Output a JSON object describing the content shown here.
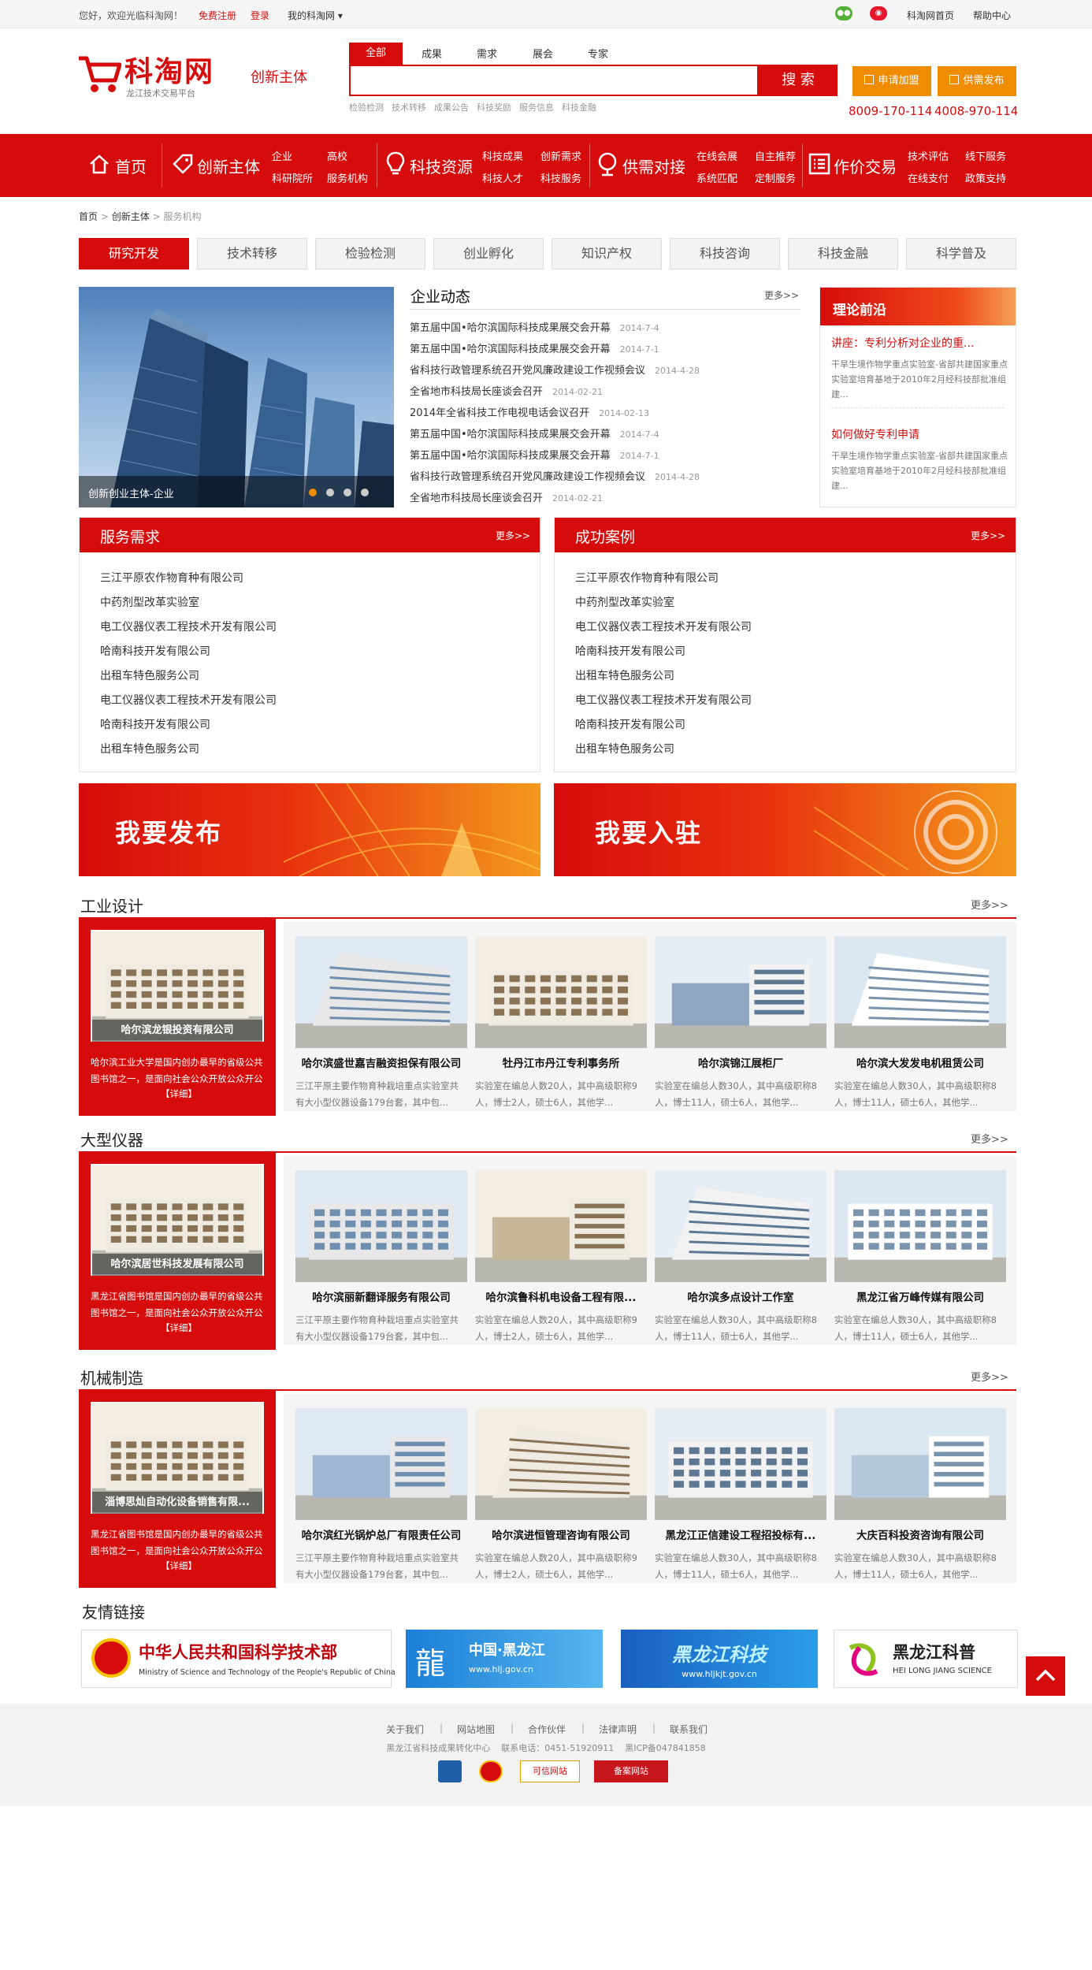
{
  "topbar": {
    "welcome": "您好，欢迎光临科淘网！",
    "register": "免费注册",
    "login": "登录",
    "my": "我的科淘网",
    "home": "科淘网首页",
    "help": "帮助中心"
  },
  "header": {
    "logo_text": "科淘网",
    "logo_sub": "龙江技术交易平台",
    "section": "创新主体",
    "search_tabs": [
      "全部",
      "成果",
      "需求",
      "展会",
      "专家"
    ],
    "search_button": "搜 索",
    "hot_words": [
      "检验检测",
      "技术转移",
      "成果公告",
      "科技奖励",
      "服务信息",
      "科技金融"
    ],
    "apply_join": "申请加盟",
    "post_demand": "供需发布",
    "phone1": "8009-170-114",
    "phone2": "4008-970-114"
  },
  "nav": {
    "items": [
      {
        "label": "首页",
        "subs": []
      },
      {
        "label": "创新主体",
        "subs": [
          "企业",
          "高校",
          "科研院所",
          "服务机构"
        ]
      },
      {
        "label": "科技资源",
        "subs": [
          "科技成果",
          "创新需求",
          "科技人才",
          "科技服务"
        ]
      },
      {
        "label": "供需对接",
        "subs": [
          "在线会展",
          "自主推荐",
          "系统匹配",
          "定制服务"
        ]
      },
      {
        "label": "作价交易",
        "subs": [
          "技术评估",
          "线下服务",
          "在线支付",
          "政策支持"
        ]
      }
    ]
  },
  "breadcrumb": [
    "首页",
    "创新主体",
    "服务机构"
  ],
  "categories": [
    "研究开发",
    "技术转移",
    "检验检测",
    "创业孵化",
    "知识产权",
    "科技咨询",
    "科技金融",
    "科学普及"
  ],
  "slider": {
    "caption": "创新创业主体-企业"
  },
  "news": {
    "title": "企业动态",
    "more": "更多>>",
    "items": [
      {
        "t": "第五届中国•哈尔滨国际科技成果展交会开幕",
        "d": "2014-7-4"
      },
      {
        "t": "第五届中国•哈尔滨国际科技成果展交会开幕",
        "d": "2014-7-1"
      },
      {
        "t": "省科技行政管理系统召开党风廉政建设工作视频会议",
        "d": "2014-4-28"
      },
      {
        "t": "全省地市科技局长座谈会召开",
        "d": "2014-02-21"
      },
      {
        "t": "2014年全省科技工作电视电话会议召开",
        "d": "2014-02-13"
      },
      {
        "t": "第五届中国•哈尔滨国际科技成果展交会开幕",
        "d": "2014-7-4"
      },
      {
        "t": "第五届中国•哈尔滨国际科技成果展交会开幕",
        "d": "2014-7-1"
      },
      {
        "t": "省科技行政管理系统召开党风廉政建设工作视频会议",
        "d": "2014-4-28"
      },
      {
        "t": "全省地市科技局长座谈会召开",
        "d": "2014-02-21"
      }
    ]
  },
  "theory": {
    "title": "理论前沿",
    "items": [
      {
        "t": "讲座：专利分析对企业的重...",
        "d": "干旱生境作物学重点实验室-省部共建国家重点实验室培育基地于2010年2月经科技部批准组建..."
      },
      {
        "t": "如何做好专利申请",
        "d": "干旱生境作物学重点实验室-省部共建国家重点实验室培育基地于2010年2月经科技部批准组建..."
      }
    ]
  },
  "service_demand": {
    "title": "服务需求",
    "more": "更多>>",
    "items": [
      "三江平原农作物育种有限公司",
      "中药剂型改革实验室",
      "电工仪器仪表工程技术开发有限公司",
      "哈南科技开发有限公司",
      "出租车特色服务公司",
      "电工仪器仪表工程技术开发有限公司",
      "哈南科技开发有限公司",
      "出租车特色服务公司"
    ]
  },
  "success_cases": {
    "title": "成功案例",
    "more": "更多>>",
    "items": [
      "三江平原农作物育种有限公司",
      "中药剂型改革实验室",
      "电工仪器仪表工程技术开发有限公司",
      "哈南科技开发有限公司",
      "出租车特色服务公司",
      "电工仪器仪表工程技术开发有限公司",
      "哈南科技开发有限公司",
      "出租车特色服务公司"
    ]
  },
  "banners": {
    "publish": "我要发布",
    "settle": "我要入驻"
  },
  "sections": [
    {
      "title": "工业设计",
      "more": "更多>>",
      "feature": {
        "name": "哈尔滨龙银投资有限公司",
        "desc": "哈尔滨工业大学是国内创办最早的省级公共图书馆之一，是面向社会公众开放公众开公众开公...",
        "detail": "【详细】"
      },
      "cards": [
        {
          "name": "哈尔滨盛世嘉吉融资担保有限公司",
          "desc": "三江平原主要作物育种栽培重点实验室共有大小型仪器设备179台套，其中包..."
        },
        {
          "name": "牡丹江市丹江专利事务所",
          "desc": "实验室在编总人数20人，其中高级职称9人，博士2人，硕士6人，其他学..."
        },
        {
          "name": "哈尔滨锦江展柜厂",
          "desc": "实验室在编总人数30人，其中高级职称8人，博士11人，硕士6人，其他学..."
        },
        {
          "name": "哈尔滨大发发电机租赁公司",
          "desc": "实验室在编总人数30人，其中高级职称8人，博士11人，硕士6人，其他学..."
        }
      ]
    },
    {
      "title": "大型仪器",
      "more": "更多>>",
      "feature": {
        "name": "哈尔滨居世科技发展有限公司",
        "desc": "黑龙江省图书馆是国内创办最早的省级公共图书馆之一，是面向社会公众开放公众开公众开公...",
        "detail": "【详细】"
      },
      "cards": [
        {
          "name": "哈尔滨丽新翻译服务有限公司",
          "desc": "三江平原主要作物育种栽培重点实验室共有大小型仪器设备179台套，其中包..."
        },
        {
          "name": "哈尔滨鲁科机电设备工程有限...",
          "desc": "实验室在编总人数20人，其中高级职称9人，博士2人，硕士6人，其他学..."
        },
        {
          "name": "哈尔滨多点设计工作室",
          "desc": "实验室在编总人数30人，其中高级职称8人，博士11人，硕士6人，其他学..."
        },
        {
          "name": "黑龙江省万峰传媒有限公司",
          "desc": "实验室在编总人数30人，其中高级职称8人，博士11人，硕士6人，其他学..."
        }
      ]
    },
    {
      "title": "机械制造",
      "more": "更多>>",
      "feature": {
        "name": "淄博思灿自动化设备销售有限...",
        "desc": "黑龙江省图书馆是国内创办最早的省级公共图书馆之一，是面向社会公众开放公众开公众开公...",
        "detail": "【详细】"
      },
      "cards": [
        {
          "name": "哈尔滨红光锅炉总厂有限责任公司",
          "desc": "三江平原主要作物育种栽培重点实验室共有大小型仪器设备179台套，其中包..."
        },
        {
          "name": "哈尔滨进恒管理咨询有限公司",
          "desc": "实验室在编总人数20人，其中高级职称9人，博士2人，硕士6人，其他学..."
        },
        {
          "name": "黑龙江正信建设工程招投标有...",
          "desc": "实验室在编总人数30人，其中高级职称8人，博士11人，硕士6人，其他学..."
        },
        {
          "name": "大庆百科投资咨询有限公司",
          "desc": "实验室在编总人数30人，其中高级职称8人，博士11人，硕士6人，其他学..."
        }
      ]
    }
  ],
  "friend_links": {
    "title": "友情链接",
    "items": [
      {
        "main": "中华人民共和国科学技术部",
        "sub": "Ministry of Science and Technology of the People's Republic of China"
      },
      {
        "main": "中国·黑龙江",
        "sub": "www.hlj.gov.cn"
      },
      {
        "main": "黑龙江科技",
        "sub": "www.hljkjt.gov.cn"
      },
      {
        "main": "黑龙江科普",
        "sub": "HEI LONG JIANG SCIENCE"
      }
    ]
  },
  "footer": {
    "links": [
      "关于我们",
      "网站地图",
      "合作伙伴",
      "法律声明",
      "联系我们"
    ],
    "org": "黑龙江省科技成果转化中心",
    "phone": "联系电话：0451-51920911",
    "icp": "黑ICP备047841858",
    "badges": [
      "可信网站",
      "备案网站"
    ]
  },
  "colors": {
    "brand": "#d60c0c",
    "orange": "#f08c00"
  }
}
